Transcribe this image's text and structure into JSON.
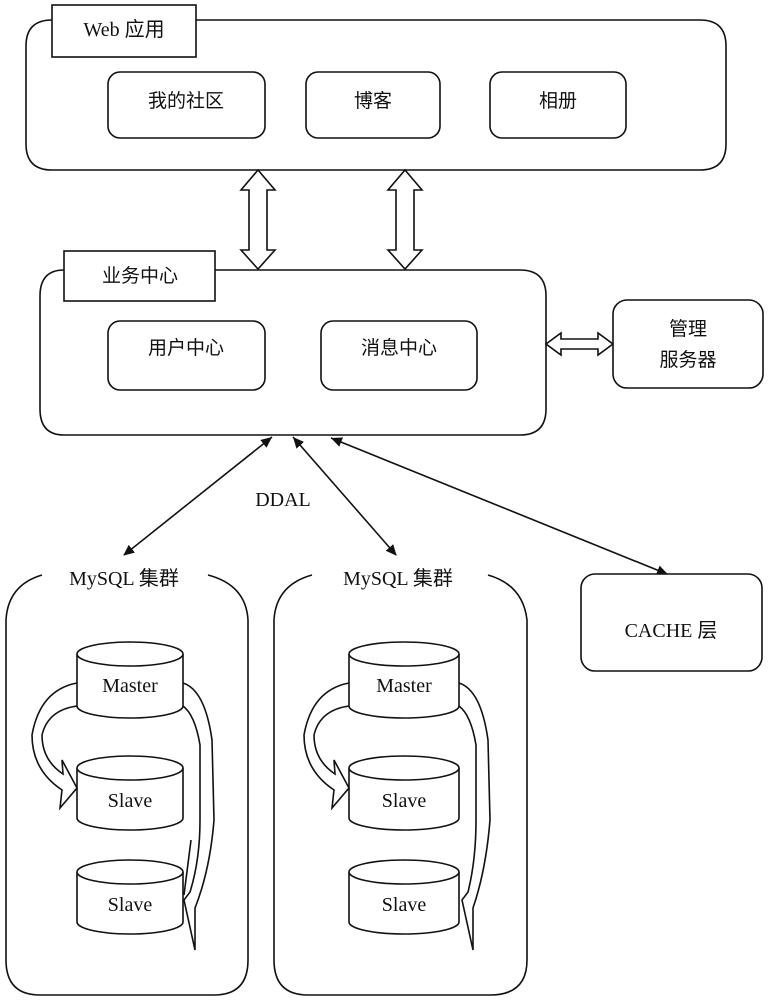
{
  "web_app": {
    "title": "Web 应用",
    "modules": [
      "我的社区",
      "博客",
      "相册"
    ]
  },
  "business_center": {
    "title": "业务中心",
    "modules": [
      "用户中心",
      "消息中心"
    ]
  },
  "management_server": {
    "line1": "管理",
    "line2": "服务器"
  },
  "ddal_label": "DDAL",
  "mysql_clusters": [
    {
      "title": "MySQL 集群",
      "master": "Master",
      "slaves": [
        "Slave",
        "Slave"
      ]
    },
    {
      "title": "MySQL 集群",
      "master": "Master",
      "slaves": [
        "Slave",
        "Slave"
      ]
    }
  ],
  "cache_layer": {
    "label": "CACHE 层"
  }
}
